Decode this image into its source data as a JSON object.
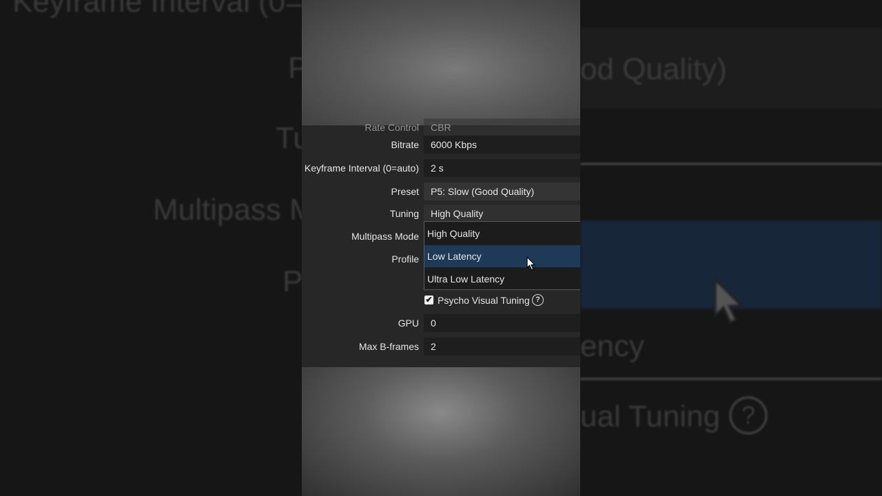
{
  "settings": {
    "cut_label": "Rate Control",
    "cut_value": "CBR",
    "rows": [
      {
        "label": "Bitrate",
        "value": "6000 Kbps"
      },
      {
        "label": "Keyframe Interval (0=auto)",
        "value": "2 s"
      },
      {
        "label": "Preset",
        "value": "P5: Slow (Good Quality)"
      },
      {
        "label": "Tuning",
        "value": "High Quality"
      },
      {
        "label": "Multipass Mode"
      },
      {
        "label": "Profile"
      }
    ],
    "tuning_options": [
      "High Quality",
      "Low Latency",
      "Ultra Low Latency"
    ],
    "tuning_highlighted": "Low Latency",
    "psycho_visual_label": "Psycho Visual Tuning",
    "psycho_visual_checked": true,
    "help_glyph": "?",
    "check_glyph": "✔",
    "gpu": {
      "label": "GPU",
      "value": "0"
    },
    "max_bframes": {
      "label": "Max B-frames",
      "value": "2"
    }
  },
  "background_zoom": {
    "left_texts": [
      "Keyframe Interval (0=",
      "P",
      "Tu",
      "Multipass M",
      "P"
    ],
    "right_texts": [
      "od Quality)",
      "ency",
      "ual Tuning"
    ],
    "help_glyph": "?"
  },
  "colors": {
    "panel_bg": "#272727",
    "field_bg": "#1e1e1e",
    "highlight": "#1f3a57",
    "text": "#e6e6e6"
  },
  "icons": [
    "mouse-cursor-icon",
    "question-circle-icon",
    "checkmark-icon"
  ]
}
